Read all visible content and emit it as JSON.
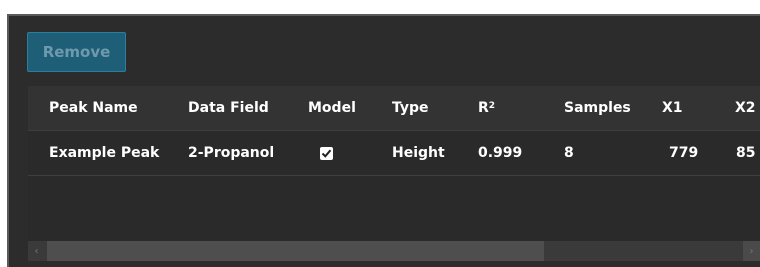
{
  "toolbar": {
    "remove_label": "Remove"
  },
  "table": {
    "columns": {
      "peak_name": "Peak Name",
      "data_field": "Data Field",
      "model": "Model",
      "type": "Type",
      "r2_base": "R",
      "r2_sup": "2",
      "samples": "Samples",
      "x1": "X1",
      "x2": "X2"
    },
    "rows": [
      {
        "peak_name": "Example Peak",
        "data_field": "2-Propanol",
        "model_checked": true,
        "type": "Height",
        "r2": "0.999",
        "samples": "8",
        "x1": "779",
        "x2": "85"
      }
    ]
  },
  "icons": {
    "checkbox": "checkmark-icon",
    "scroll_left": "chevron-left-icon",
    "scroll_right": "chevron-right-icon"
  },
  "colors": {
    "panel_bg": "#2c2c2c",
    "button_bg": "#1f5e77",
    "button_text": "#6e9aad"
  }
}
